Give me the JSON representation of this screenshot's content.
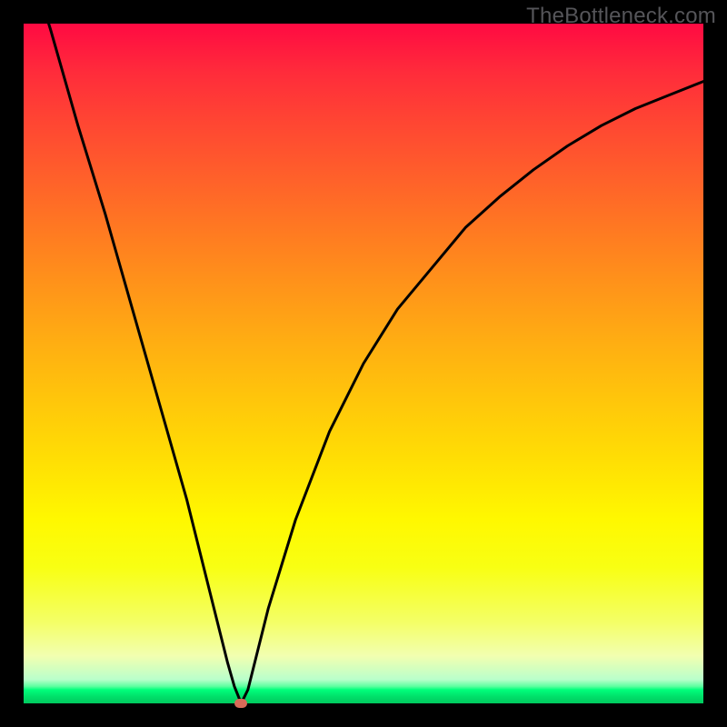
{
  "watermark": "TheBottleneck.com",
  "colors": {
    "top": "#ff0a42",
    "bottom": "#00c95e",
    "curve": "#000000",
    "marker": "#d86a58",
    "frame": "#000000"
  },
  "chart_data": {
    "type": "line",
    "title": "",
    "xlabel": "",
    "ylabel": "",
    "xlim": [
      0,
      100
    ],
    "ylim": [
      0,
      100
    ],
    "note": "No axis ticks or labels visible; values below are estimated from pixel positions on a 0-100 normalized grid. Curve is a V-shaped bottleneck plot reaching ~0 at x≈32.",
    "minimum": {
      "x": 32,
      "y": 0
    },
    "series": [
      {
        "name": "bottleneck-curve",
        "x": [
          0,
          4,
          8,
          12,
          16,
          20,
          24,
          28,
          30,
          31,
          32,
          33,
          34,
          36,
          40,
          45,
          50,
          55,
          60,
          65,
          70,
          75,
          80,
          85,
          90,
          95,
          100
        ],
        "values": [
          112,
          99,
          85,
          72,
          58,
          44,
          30,
          14,
          6,
          2.5,
          0,
          2,
          6,
          14,
          27,
          40,
          50,
          58,
          64,
          70,
          74.5,
          78.5,
          82,
          85,
          87.5,
          89.5,
          91.5
        ]
      }
    ],
    "marker_point": {
      "x": 32,
      "y": 0
    }
  }
}
